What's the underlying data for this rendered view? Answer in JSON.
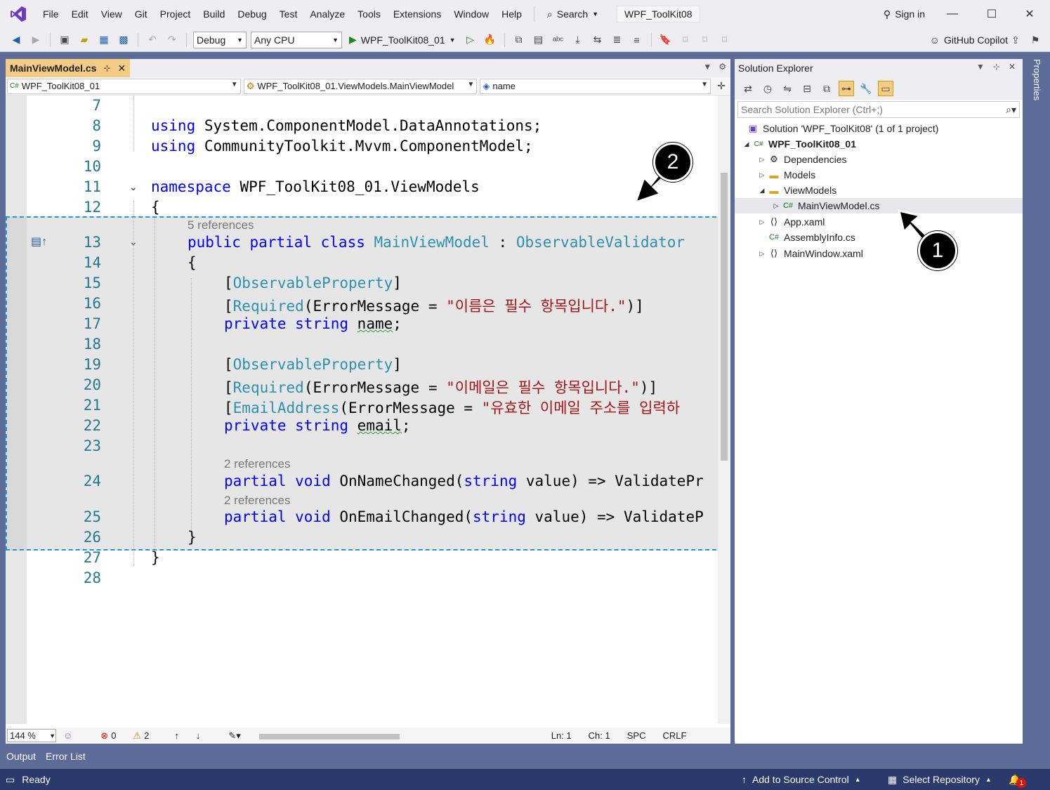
{
  "menu": {
    "items": [
      "File",
      "Edit",
      "View",
      "Git",
      "Project",
      "Build",
      "Debug",
      "Test",
      "Analyze",
      "Tools",
      "Extensions",
      "Window",
      "Help"
    ],
    "search_label": "Search",
    "solution_title": "WPF_ToolKit08",
    "sign_in": "Sign in"
  },
  "toolbar": {
    "config": "Debug",
    "platform": "Any CPU",
    "start_label": "WPF_ToolKit08_01",
    "copilot": "GitHub Copilot"
  },
  "editor": {
    "tab_title": "MainViewModel.cs",
    "nav_project": "WPF_ToolKit08_01",
    "nav_class": "WPF_ToolKit08_01.ViewModels.MainViewModel",
    "nav_member": "name",
    "line_numbers": [
      "7",
      "8",
      "9",
      "10",
      "11",
      "12",
      "13",
      "14",
      "15",
      "16",
      "17",
      "18",
      "19",
      "20",
      "21",
      "22",
      "23",
      "24",
      "25",
      "26",
      "27",
      "28"
    ],
    "references": [
      "5 references",
      "2 references",
      "2 references"
    ],
    "code": {
      "l8_kw": "using",
      "l8_tx": " System.ComponentModel.DataAnnotations;",
      "l9_kw": "using",
      "l9_tx": " CommunityToolkit.Mvvm.ComponentModel;",
      "l11_kw": "namespace",
      "l11_tx": " WPF_ToolKit08_01.ViewModels",
      "l12_tx": "{",
      "l13_kw": "public partial class",
      "l13_ty": "MainViewModel",
      "l13_sep": " : ",
      "l13_base": "ObservableValidator",
      "l14_tx": "{",
      "l15_open": "[",
      "l15_ty": "ObservableProperty",
      "l15_close": "]",
      "l16_open": "[",
      "l16_ty": "Required",
      "l16_mid": "(ErrorMessage = ",
      "l16_st": "\"이름은 필수 항목입니다.\"",
      "l16_close": ")]",
      "l17_kw": "private string",
      "l17_sp": " ",
      "l17_var": "name",
      "l17_end": ";",
      "l19_open": "[",
      "l19_ty": "ObservableProperty",
      "l19_close": "]",
      "l20_open": "[",
      "l20_ty": "Required",
      "l20_mid": "(ErrorMessage = ",
      "l20_st": "\"이메일은 필수 항목입니다.\"",
      "l20_close": ")]",
      "l21_open": "[",
      "l21_ty": "EmailAddress",
      "l21_mid": "(ErrorMessage = ",
      "l21_st": "\"유효한 이메일 주소를 입력하",
      "l22_kw": "private string",
      "l22_sp": " ",
      "l22_var": "email",
      "l22_end": ";",
      "l24_kw1": "partial void",
      "l24_tx1": " OnNameChanged(",
      "l24_kw2": "string",
      "l24_tx2": " value) => ValidatePr",
      "l25_kw1": "partial void",
      "l25_tx1": " OnEmailChanged(",
      "l25_kw2": "string",
      "l25_tx2": " value) => ValidateP",
      "l26_tx": "}",
      "l27_tx": "}"
    },
    "zoom": "144 %",
    "errors": "0",
    "warnings": "2",
    "ln": "Ln: 1",
    "ch": "Ch: 1",
    "spc": "SPC",
    "crlf": "CRLF"
  },
  "solution_explorer": {
    "title": "Solution Explorer",
    "search_placeholder": "Search Solution Explorer (Ctrl+;)",
    "items": [
      {
        "label": "Solution 'WPF_ToolKit08' (1 of 1 project)"
      },
      {
        "label": "WPF_ToolKit08_01"
      },
      {
        "label": "Dependencies"
      },
      {
        "label": "Models"
      },
      {
        "label": "ViewModels"
      },
      {
        "label": "MainViewModel.cs"
      },
      {
        "label": "App.xaml"
      },
      {
        "label": "AssemblyInfo.cs"
      },
      {
        "label": "MainWindow.xaml"
      }
    ],
    "properties_tab": "Properties"
  },
  "bottom": {
    "output": "Output",
    "error_list": "Error List",
    "ready": "Ready",
    "add_source": "Add to Source Control",
    "select_repo": "Select Repository",
    "notif_count": "1"
  },
  "callouts": [
    "1",
    "2"
  ],
  "colors": {
    "accent": "#5d6b99",
    "tab_active": "#f5cc84",
    "keyword": "#0000ff",
    "type": "#2b91af",
    "string": "#a31515",
    "statusbar": "#2b3a6b"
  }
}
